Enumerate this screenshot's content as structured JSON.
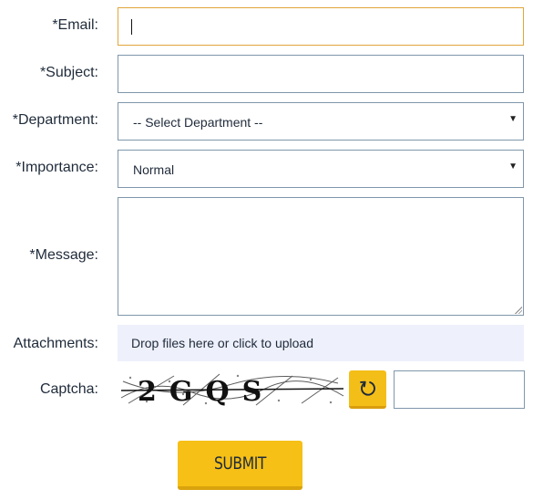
{
  "form": {
    "email": {
      "label": "*Email:",
      "value": ""
    },
    "subject": {
      "label": "*Subject:",
      "value": ""
    },
    "department": {
      "label": "*Department:",
      "selected": "-- Select Department --"
    },
    "importance": {
      "label": "*Importance:",
      "selected": "Normal"
    },
    "message": {
      "label": "*Message:",
      "value": ""
    },
    "attachments": {
      "label": "Attachments:",
      "dropzone_text": "Drop files here or click to upload"
    },
    "captcha": {
      "label": "Captcha:",
      "image_text": "2GQS",
      "refresh_icon": "refresh-icon",
      "value": ""
    },
    "submit_label": "SUBMIT"
  },
  "colors": {
    "accent_yellow": "#f6c016",
    "field_border": "#7f97ab",
    "focus_border": "#e0a63a",
    "dropzone_bg": "#eef0fb",
    "text": "#1f2b3a"
  }
}
